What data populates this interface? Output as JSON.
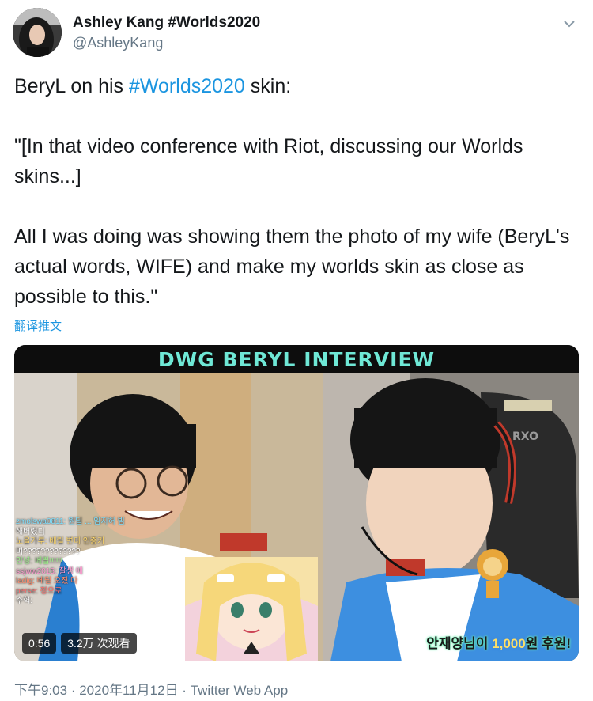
{
  "author": {
    "display_name": "Ashley Kang #Worlds2020",
    "handle": "@AshleyKang",
    "avatar_icon": "profile-avatar-icon"
  },
  "tweet": {
    "line1_prefix": "BeryL on his ",
    "line1_hashtag": "#Worlds2020",
    "line1_suffix": " skin:",
    "paragraph2": "\"[In that video conference with Riot, discussing our Worlds skins...]",
    "paragraph3": "All I was doing was showing them the photo of my wife (BeryL's actual words, WIFE) and make my worlds skin as close as possible to this.\"",
    "translate_label": "翻译推文"
  },
  "media": {
    "banner_title": "DWG BERYL INTERVIEW",
    "duration": "0:56",
    "views": "3.2万 次观看",
    "chat_lines": [
      "zmolswa0811: 원딜 ... 임지허 빔",
      "해버렸디",
      "노을가루: 베릴 변티 인증기",
      "며?????????????",
      "안녕: 베릴!!!!!!",
      "ssjww2015: 잘생 에",
      "ladig: 베릴 오졌 다",
      "perse: 정으로",
      "수혁:"
    ],
    "donation_name": "안재양",
    "donation_mid": "님이 ",
    "donation_amount": "1,000",
    "donation_suffix": "원 후원!",
    "banner_color": "#6fe8d6"
  },
  "meta": {
    "time": "下午9:03",
    "date": "2020年11月12日",
    "separator": " · ",
    "source": "Twitter Web App"
  },
  "colors": {
    "link": "#1b95e0",
    "text": "#14171a",
    "secondary": "#657786"
  },
  "icons": {
    "caret": "chevron-down-icon"
  }
}
